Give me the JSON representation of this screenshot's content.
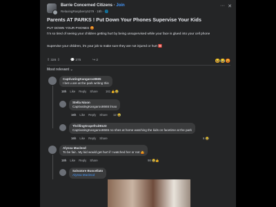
{
  "post": {
    "group": "Barrie Concerned Citizens",
    "join": "Join",
    "author_meta": "RelaxingRaspberry5279 · 18h · 🌐",
    "title": "Parents AT PARKS ! Put Down Your Phones Supervise Your Kids",
    "body": [
      "PUT DOWN YOUR PHONES 😡",
      "I'm so tired of seeing your children getting hurt by being unsupervised while your face is glued into your cell phone",
      "Supervise your children, it's your job to make sure they are not injured or hurt 🆘"
    ],
    "upvotes": "326",
    "comments": "275",
    "shares": "2",
    "sort": "Most relevant ⌄"
  },
  "comments": [
    {
      "author": "CaptivatingKangaroo8665",
      "text": "I bet u are at the park writing this",
      "time": "18h",
      "reacts": "161"
    },
    {
      "author": "Stella Nixon",
      "text": "CaptivatingKangaroo8665 lmao",
      "time": "16h",
      "reacts": "12"
    },
    {
      "author": "ThrillingGrapefruit8123",
      "text": "CaptivatingKangaroo8665 no shes at home watching the kids on facetime at the park",
      "time": "16h",
      "reacts": "6"
    },
    {
      "author": "Alyssa Macleod",
      "text": "To be fair.. My kid would get hurt if I watched her or not 🤷",
      "time": "18h",
      "reacts": "98"
    },
    {
      "author": "Salvatore Buscellato",
      "text": "Alyssa Macleod",
      "time": "",
      "reacts": ""
    }
  ],
  "labels": {
    "like": "Like",
    "reply": "Reply",
    "share": "Share"
  }
}
